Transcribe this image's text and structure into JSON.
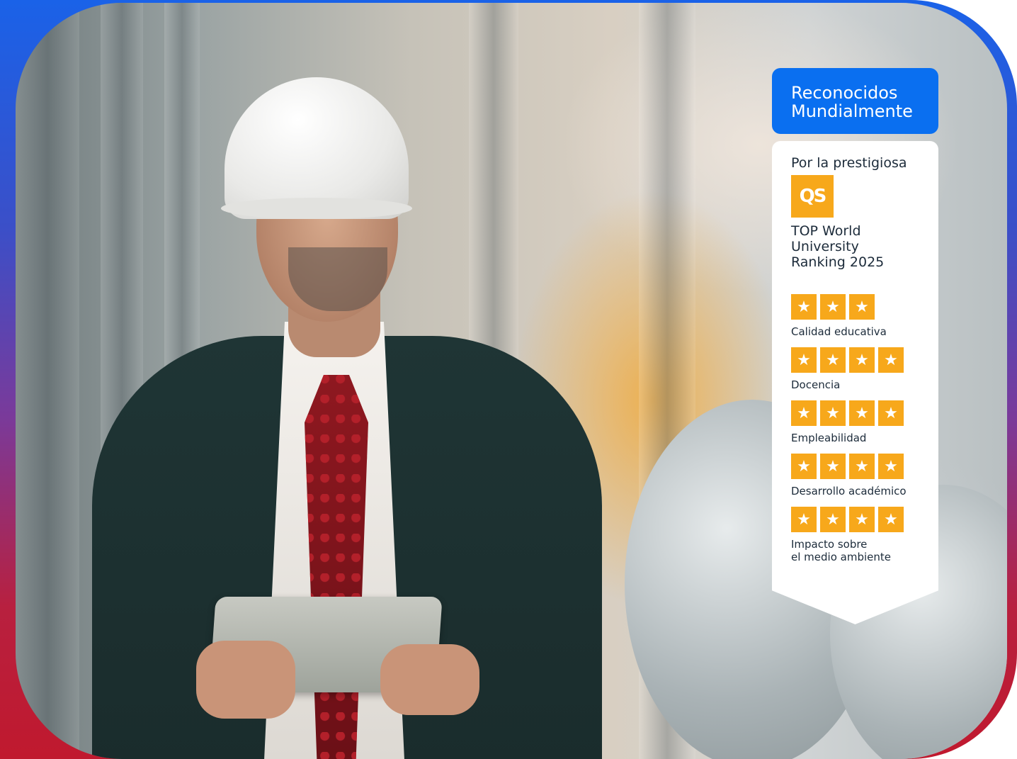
{
  "badge": {
    "header_line1": "Reconocidos",
    "header_line2": "Mundialmente",
    "intro": "Por la prestigiosa",
    "logo_text": "QS",
    "ranking_line1": "TOP World",
    "ranking_line2": "University",
    "ranking_line3": "Ranking 2025",
    "criteria": [
      {
        "label": "Calidad educativa",
        "label2": "",
        "stars": 3
      },
      {
        "label": "Docencia",
        "label2": "",
        "stars": 4
      },
      {
        "label": "Empleabilidad",
        "label2": "",
        "stars": 4
      },
      {
        "label": "Desarrollo académico",
        "label2": "",
        "stars": 4
      },
      {
        "label": "Impacto sobre",
        "label2": "el medio ambiente",
        "stars": 4
      }
    ]
  },
  "colors": {
    "header_blue": "#0a6ff0",
    "star_orange": "#f7a81b",
    "text_dark": "#1c2b3a"
  },
  "photo": {
    "subject": "engineer-in-hard-hat-holding-tablet"
  }
}
